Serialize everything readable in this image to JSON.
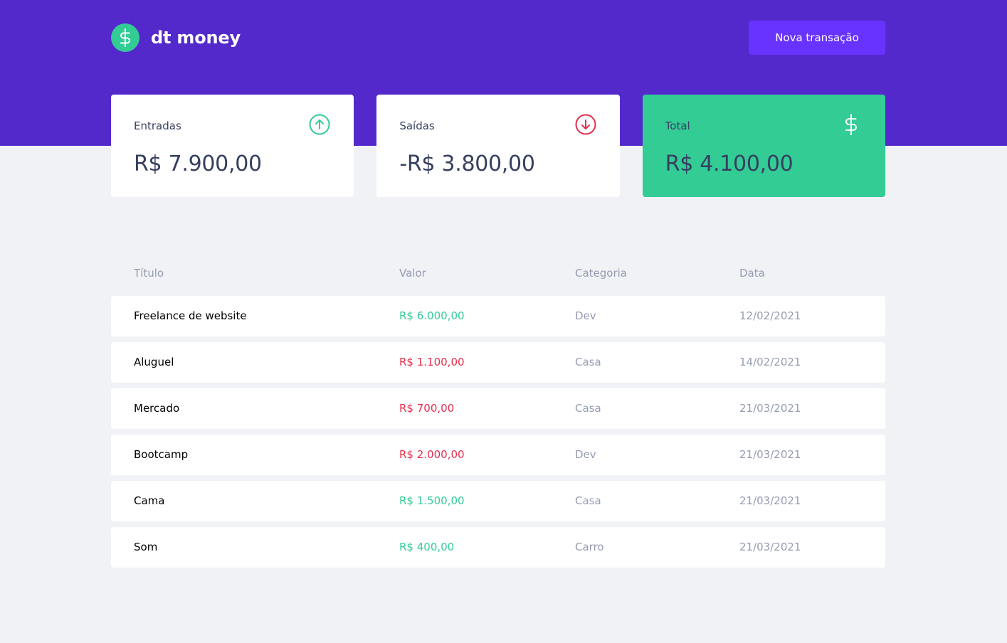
{
  "header": {
    "app_name": "dt money",
    "new_transaction_label": "Nova transação"
  },
  "summary": {
    "income": {
      "label": "Entradas",
      "value": "R$ 7.900,00",
      "icon": "arrow-up-circle-icon"
    },
    "outcome": {
      "label": "Saídas",
      "value": "-R$ 3.800,00",
      "icon": "arrow-down-circle-icon"
    },
    "total": {
      "label": "Total",
      "value": "R$ 4.100,00",
      "icon": "dollar-sign-icon"
    }
  },
  "table": {
    "headers": [
      "Título",
      "Valor",
      "Categoria",
      "Data"
    ],
    "rows": [
      {
        "title": "Freelance de website",
        "amount": "R$ 6.000,00",
        "type": "deposit",
        "category": "Dev",
        "date": "12/02/2021"
      },
      {
        "title": "Aluguel",
        "amount": "R$ 1.100,00",
        "type": "withdraw",
        "category": "Casa",
        "date": "14/02/2021"
      },
      {
        "title": "Mercado",
        "amount": "R$ 700,00",
        "type": "withdraw",
        "category": "Casa",
        "date": "21/03/2021"
      },
      {
        "title": "Bootcamp",
        "amount": "R$ 2.000,00",
        "type": "withdraw",
        "category": "Dev",
        "date": "21/03/2021"
      },
      {
        "title": "Cama",
        "amount": "R$ 1.500,00",
        "type": "deposit",
        "category": "Casa",
        "date": "21/03/2021"
      },
      {
        "title": "Som",
        "amount": "R$ 400,00",
        "type": "deposit",
        "category": "Carro",
        "date": "21/03/2021"
      }
    ]
  },
  "colors": {
    "brand_purple": "#5429CC",
    "button_purple": "#6933FF",
    "green": "#33CC95",
    "red": "#E52E4D",
    "text_title": "#363F5F",
    "text_body": "#969CB3",
    "background": "#F0F2F5"
  }
}
